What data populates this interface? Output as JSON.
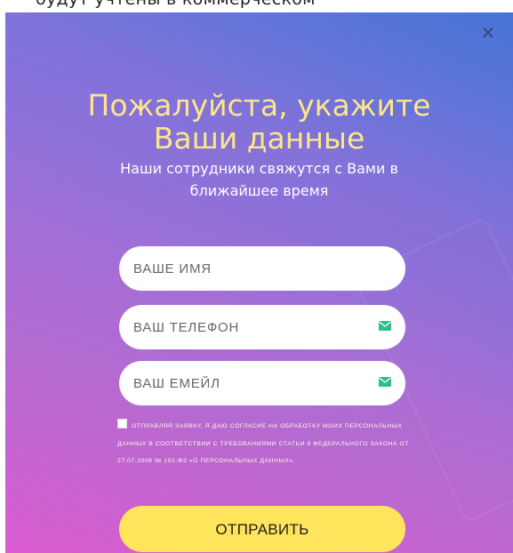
{
  "background_text": "будут учтены в коммерческом",
  "modal": {
    "close_glyph": "×",
    "title_line1": "Пожалуйста, укажите",
    "title_line2": "Ваши данные",
    "subtitle_line1": "Наши сотрудники свяжутся с Вами в",
    "subtitle_line2": "ближайшее время",
    "fields": {
      "name": {
        "placeholder": "ВАШЕ ИМЯ",
        "value": ""
      },
      "phone": {
        "placeholder": "ВАШ ТЕЛЕФОН",
        "value": "",
        "icon": "envelope-icon"
      },
      "email": {
        "placeholder": "ВАШ ЕМЕЙЛ",
        "value": "",
        "icon": "envelope-icon"
      }
    },
    "consent": {
      "checked": false,
      "text": "Отправляя заявку, я даю согласие на обработку моих персональных данных в соответствии с требованиями статьи 9 Федерального закона от 27.07.2006 № 152-ФЗ «О персональных данных»."
    },
    "submit_label": "ОТПРАВИТЬ"
  },
  "colors": {
    "gradient_top": "#4f7bd8",
    "gradient_bottom": "#d95bcf",
    "title": "#fde68a",
    "button": "#ffe45c",
    "icon": "#2bbf8a"
  }
}
